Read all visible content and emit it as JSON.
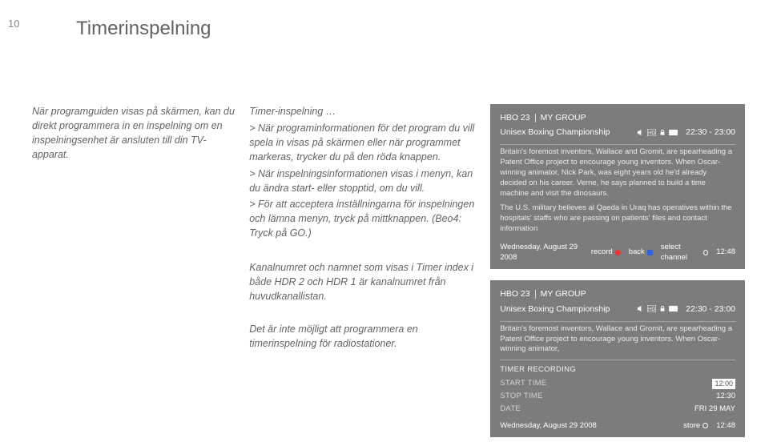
{
  "page_number": "10",
  "title": "Timerinspelning",
  "left_para": "När programguiden visas på skärmen, kan du direkt programmera in en inspelning om en inspelningsenhet är ansluten till din TV-apparat.",
  "mid": {
    "heading": "Timer-inspelning …",
    "b1": "> När programinformationen för det program du vill spela in visas på skärmen eller när programmet markeras, trycker du på den röda knappen.",
    "b2": "> När inspelningsinformationen visas i menyn, kan du ändra start- eller stopptid, om du vill.",
    "b3": "> För att acceptera inställningarna för inspelningen och lämna menyn, tryck på mittknappen. (Beo4: Tryck på GO.)",
    "sub1": "Kanalnumret och namnet som visas i Timer index i både HDR 2 och HDR 1 är kanalnumret från huvudkanallistan.",
    "sub2": "Det är inte möjligt att programmera en timerinspelning för radiostationer."
  },
  "panel1": {
    "channel": "HBO 23",
    "group": "MY GROUP",
    "show": "Unisex Boxing Championship",
    "time": "22:30 - 23:00",
    "para1": "Britain's foremost inventors, Wallace and Gromit, are spearheading a Patent Office project to encourage young inventors. When Oscar-winning animator, Nick Park, was eight years old he'd already decided on his career. Verne, he says planned to build a time machine and visit the dinosaurs.",
    "para2": "The U.S. military believes al Qaeda in Uraq has operatives within the hospitals' staffs who are passing on patients' files and contact information",
    "date": "Wednesday, August 29 2008",
    "action_record": "record",
    "action_back": "back",
    "action_select": "select channel",
    "clock": "12:48"
  },
  "panel2": {
    "channel": "HBO 23",
    "group": "MY GROUP",
    "show": "Unisex Boxing Championship",
    "time": "22:30 - 23:00",
    "para1": "Britain's foremost inventors, Wallace and Gromit, are spearheading a Patent Office project to encourage young inventors. When Oscar-winning animator,",
    "timer_heading": "TIMER RECORDING",
    "start_label": "START TIME",
    "start_val": "12:00",
    "stop_label": "STOP TIME",
    "stop_val": "12:30",
    "date_label": "DATE",
    "date_val": "FRI 29 MAY",
    "date": "Wednesday, August 29 2008",
    "action_store": "store",
    "clock": "12:48"
  }
}
